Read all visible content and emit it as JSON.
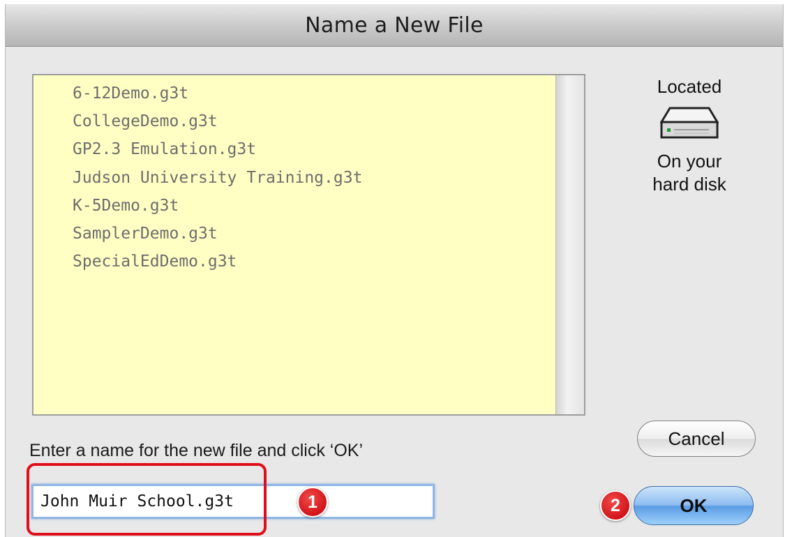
{
  "window": {
    "title": "Name a New File"
  },
  "file_list": {
    "items": [
      "6-12Demo.g3t",
      "CollegeDemo.g3t",
      "GP2.3 Emulation.g3t",
      "Judson University Training.g3t",
      "K-5Demo.g3t",
      "SamplerDemo.g3t",
      "SpecialEdDemo.g3t"
    ]
  },
  "location": {
    "label": "Located",
    "icon": "hard-disk-icon",
    "caption_line1": "On your",
    "caption_line2": "hard disk"
  },
  "prompt": "Enter a name for the new file and click ‘OK’",
  "name_field": {
    "value": "John Muir School.g3t"
  },
  "buttons": {
    "cancel": "Cancel",
    "ok": "OK"
  },
  "annotations": {
    "step1": "1",
    "step2": "2",
    "highlight_color": "#e00e1b"
  },
  "colors": {
    "list_background": "#ffffc4",
    "list_text": "#6d6d6d",
    "ok_button": "#5a9ce4"
  }
}
